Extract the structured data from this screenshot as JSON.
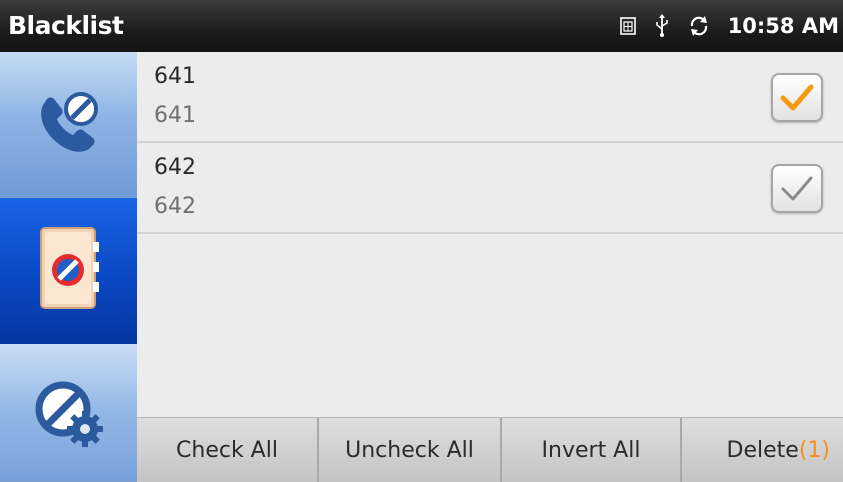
{
  "statusbar": {
    "title": "Blacklist",
    "time": "10:58 AM",
    "icons": [
      "sim-icon",
      "usb-icon",
      "sync-icon"
    ]
  },
  "sidebar": {
    "tabs": [
      {
        "icon": "blocked-call-icon",
        "active": false
      },
      {
        "icon": "blocked-contacts-icon",
        "active": true
      },
      {
        "icon": "block-settings-icon",
        "active": false
      }
    ]
  },
  "list": {
    "items": [
      {
        "name": "641",
        "number": "641",
        "checked": true,
        "check_color": "#f39c12"
      },
      {
        "name": "642",
        "number": "642",
        "checked": true,
        "check_color": "#8c8c8c"
      }
    ]
  },
  "toolbar": {
    "check_all": "Check All",
    "uncheck_all": "Uncheck All",
    "invert_all": "Invert All",
    "delete_label": "Delete",
    "delete_count": "(1)"
  },
  "colors": {
    "active_tab": "#0a48c4",
    "count_accent": "#f5901e"
  }
}
